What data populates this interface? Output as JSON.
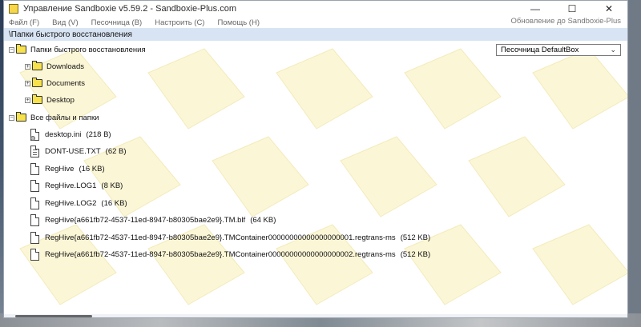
{
  "window": {
    "title": "Управление Sandboxie v5.59.2 - Sandboxie-Plus.com"
  },
  "menu": {
    "items": [
      "Файл (F)",
      "Вид (V)",
      "Песочница (B)",
      "Настроить (C)",
      "Помощь (H)"
    ],
    "right": "Обновление до Sandboxie-Plus"
  },
  "path": "\\Папки быстрого восстановления",
  "sandbox_select": {
    "value": "Песочница DefaultBox"
  },
  "tree": {
    "quick_root": "Папки быстрого восстановления",
    "quick_folders": [
      "Downloads",
      "Documents",
      "Desktop"
    ],
    "all_root": "Все файлы и папки",
    "files": [
      {
        "name": "desktop.ini",
        "size": "(218 B)",
        "icon": "settings-file-icon"
      },
      {
        "name": "DONT-USE.TXT",
        "size": "(62 B)",
        "icon": "text-file-icon"
      },
      {
        "name": "RegHive",
        "size": "(16 KB)",
        "icon": "file-icon"
      },
      {
        "name": "RegHive.LOG1",
        "size": "(8 KB)",
        "icon": "file-icon"
      },
      {
        "name": "RegHive.LOG2",
        "size": "(16 KB)",
        "icon": "file-icon"
      },
      {
        "name": "RegHive{a661fb72-4537-11ed-8947-b80305bae2e9}.TM.blf",
        "size": "(64 KB)",
        "icon": "file-icon"
      },
      {
        "name": "RegHive{a661fb72-4537-11ed-8947-b80305bae2e9}.TMContainer00000000000000000001.regtrans-ms",
        "size": "(512 KB)",
        "icon": "file-icon"
      },
      {
        "name": "RegHive{a661fb72-4537-11ed-8947-b80305bae2e9}.TMContainer00000000000000000002.regtrans-ms",
        "size": "(512 KB)",
        "icon": "file-icon"
      }
    ]
  },
  "colors": {
    "path_bar": "#d8e4f3",
    "folder": "#f7e24c",
    "watermark": "#fbf6d6"
  }
}
